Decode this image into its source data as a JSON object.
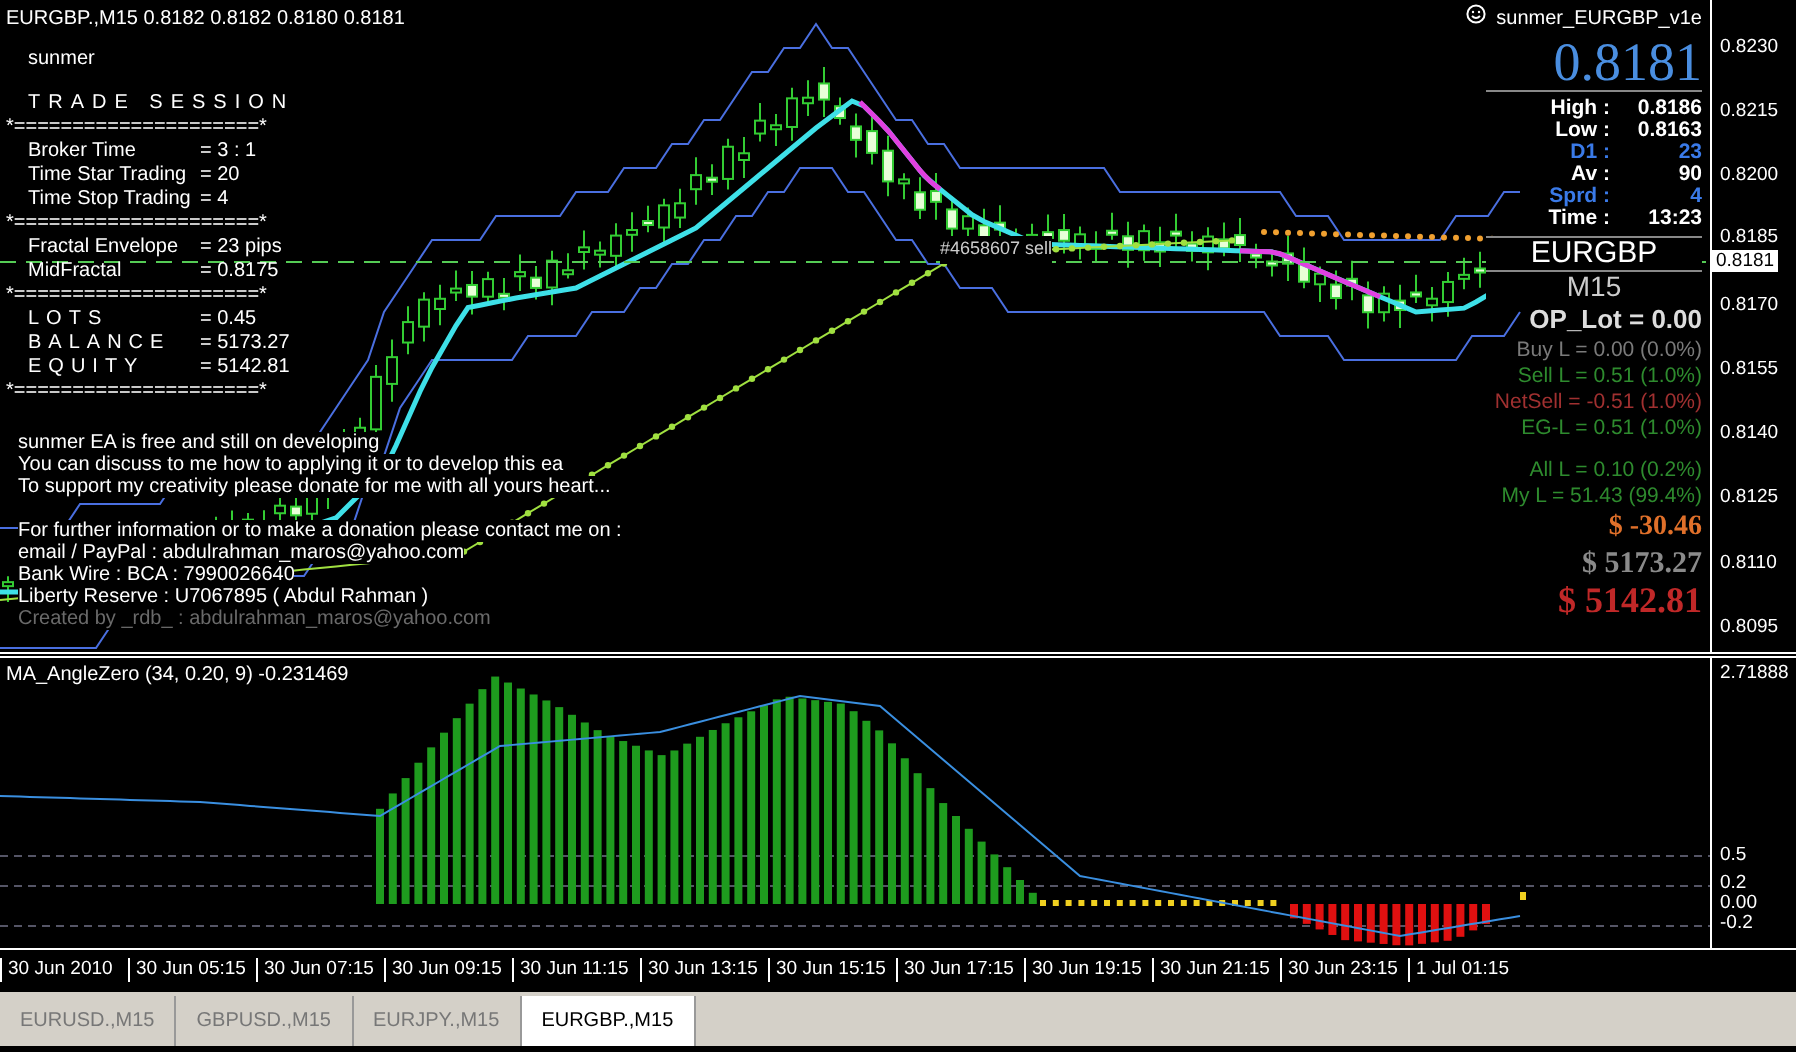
{
  "header": {
    "quote": "EURGBP.,M15  0.8182 0.8182 0.8180 0.8181"
  },
  "info_panel": {
    "title": "sunmer",
    "lines": [
      {
        "kind": "heading",
        "text": "TRADE SESSION"
      },
      {
        "kind": "separator",
        "text": "*=====================*"
      },
      {
        "kind": "pair",
        "label": "Broker Time",
        "value": "= 3 : 1"
      },
      {
        "kind": "pair",
        "label": "Time Star Trading",
        "value": "= 20"
      },
      {
        "kind": "pair",
        "label": "Time Stop Trading",
        "value": "= 4"
      },
      {
        "kind": "separator",
        "text": "*=====================*"
      },
      {
        "kind": "pair",
        "label": "Fractal Envelope",
        "value": "= 23 pips"
      },
      {
        "kind": "pair",
        "label": "MidFractal",
        "value": "= 0.8175"
      },
      {
        "kind": "separator",
        "text": "*=====================*"
      },
      {
        "kind": "spaced_pair",
        "label": "LOTS",
        "value": "= 0.45"
      },
      {
        "kind": "spaced_pair",
        "label": "BALANCE",
        "value": "= 5173.27"
      },
      {
        "kind": "spaced_pair",
        "label": "EQUITY",
        "value": "= 5142.81"
      },
      {
        "kind": "separator",
        "text": "*=====================*"
      }
    ]
  },
  "message_blocks": [
    {
      "lines": [
        "sunmer  EA is free and still on developing",
        "You can discuss to me how to applying it or to develop this ea",
        "To support my creativity please donate for me with all yours heart..."
      ]
    },
    {
      "lines": [
        "For further information or to make a donation please contact me on :",
        "email / PayPal : abdulrahman_maros@yahoo.com",
        "Bank Wire : BCA : 7990026640",
        "Liberty Reserve : U7067895 ( Abdul Rahman )"
      ]
    }
  ],
  "credit": "Created by _rdb_ : abdulrahman_maros@yahoo.com",
  "order_line": {
    "label": "#4658607 sell"
  },
  "ea_panel": {
    "name": "sunmer_EURGBP_v1e",
    "price": "0.8181",
    "stats": [
      {
        "label": "High :",
        "value": "0.8186",
        "highlight": false
      },
      {
        "label": "Low :",
        "value": "0.8163",
        "highlight": false
      },
      {
        "label": "D1 :",
        "value": "23",
        "highlight": true
      },
      {
        "label": "Av :",
        "value": "90",
        "highlight": false
      },
      {
        "label": "Sprd :",
        "value": "4",
        "highlight": true
      },
      {
        "label": "Time :",
        "value": "13:23",
        "highlight": false
      }
    ],
    "symbol": "EURGBP",
    "timeframe": "M15",
    "op_lot": "OP_Lot = 0.00",
    "levels": [
      {
        "text": "Buy L = 0.00 (0.0%)",
        "color": "#7a7a7a"
      },
      {
        "text": "Sell L = 0.51 (1.0%)",
        "color": "#2e8b2e"
      },
      {
        "text": "NetSell = -0.51 (1.0%)",
        "color": "#a03030"
      },
      {
        "text": "EG-L = 0.51 (1.0%)",
        "color": "#2e8b2e"
      }
    ],
    "totals": [
      {
        "text": "All L =  0.10 (0.2%)",
        "color": "#2e8b2e"
      },
      {
        "text": "My L = 51.43 (99.4%)",
        "color": "#2e8b2e"
      }
    ],
    "money": [
      {
        "text": "$ -30.46",
        "color": "#e0702a"
      },
      {
        "text": "$ 5173.27",
        "color": "#8a8a8a"
      },
      {
        "text": "$ 5142.81",
        "color": "#c02828"
      }
    ]
  },
  "price_axis": {
    "labels": [
      "0.8230",
      "0.8215",
      "0.8200",
      "0.8185",
      "0.8170",
      "0.8155",
      "0.8140",
      "0.8125",
      "0.8110",
      "0.8095"
    ],
    "current": "0.8181"
  },
  "indicator": {
    "title": "MA_AngleZero (34, 0.20, 9) -0.231469",
    "axis_labels": [
      "2.71888",
      "0.5",
      "0.2",
      "0.00",
      "-0.2"
    ]
  },
  "time_axis": {
    "labels": [
      "30 Jun 2010",
      "30 Jun 05:15",
      "30 Jun 07:15",
      "30 Jun 09:15",
      "30 Jun 11:15",
      "30 Jun 13:15",
      "30 Jun 15:15",
      "30 Jun 17:15",
      "30 Jun 19:15",
      "30 Jun 21:15",
      "30 Jun 23:15",
      "1 Jul 01:15"
    ]
  },
  "tabs": [
    {
      "label": "EURUSD.,M15",
      "selected": false
    },
    {
      "label": "GBPUSD.,M15",
      "selected": false
    },
    {
      "label": "EURJPY.,M15",
      "selected": false
    },
    {
      "label": "EURGBP.,M15",
      "selected": true
    }
  ]
}
